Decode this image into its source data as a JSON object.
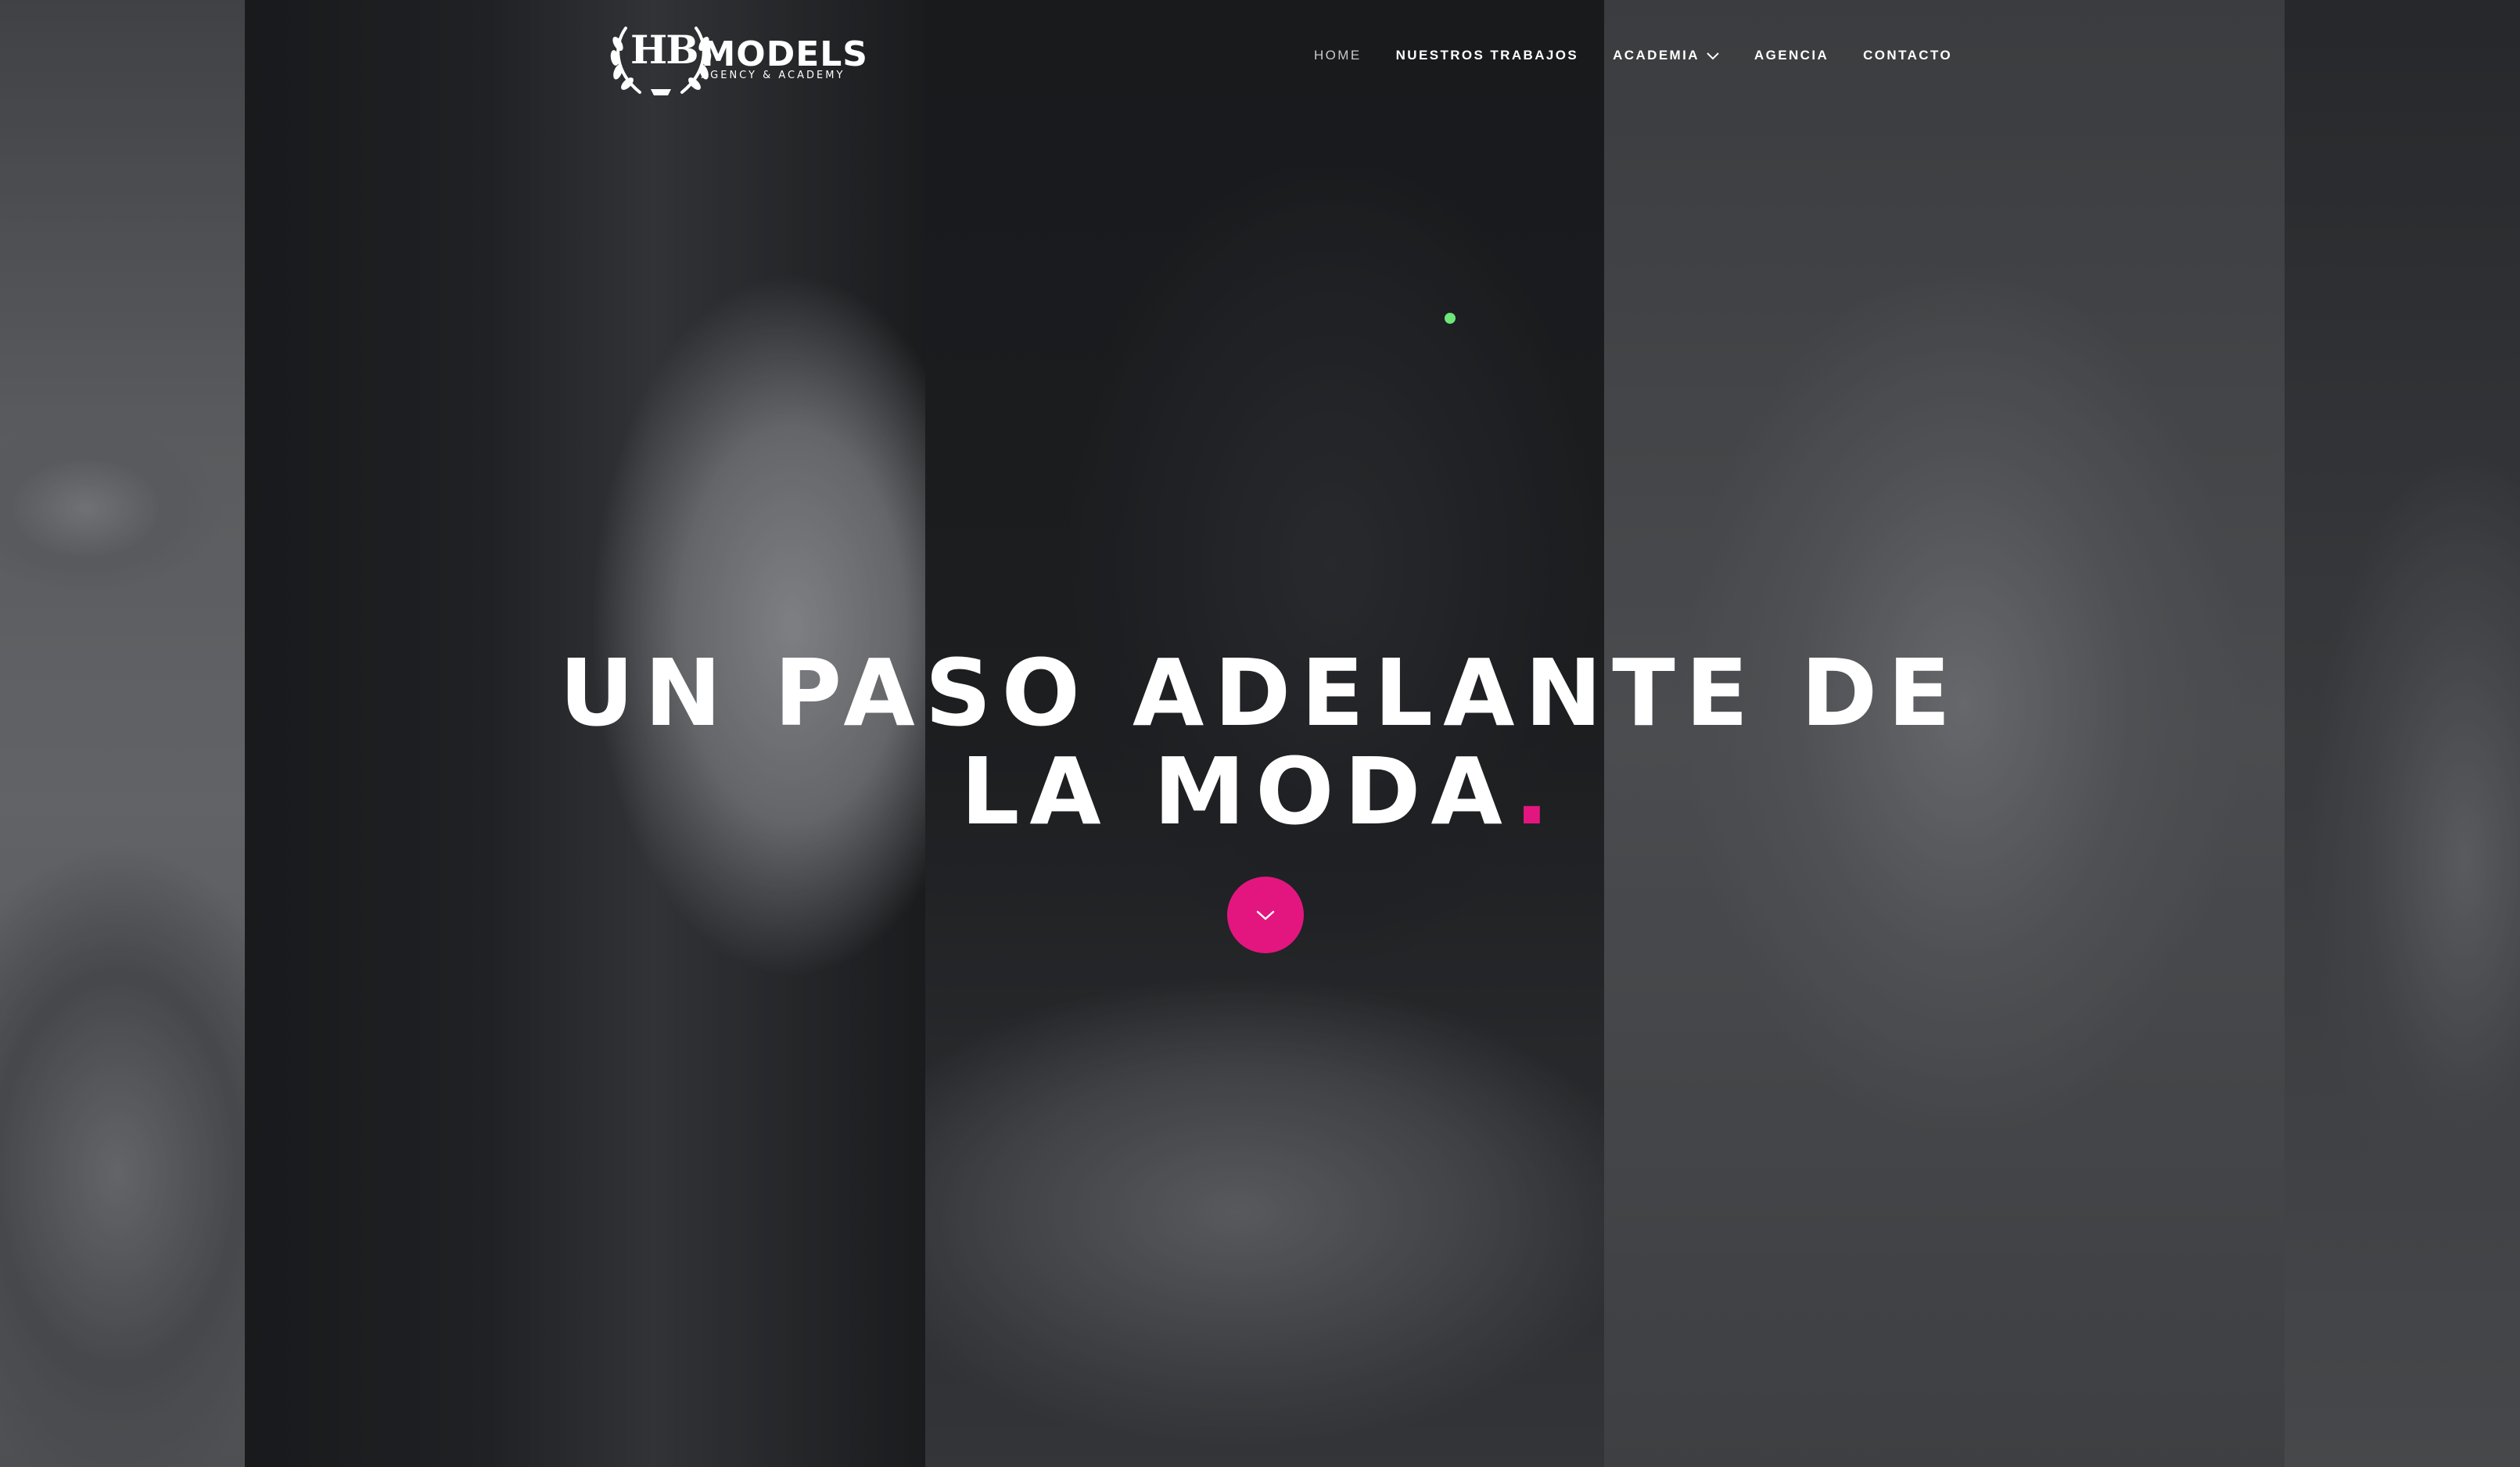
{
  "brand": {
    "emblem_text": "HB",
    "name": "MODELS",
    "tagline": "AGENCY & ACADEMY"
  },
  "nav": {
    "items": [
      {
        "label": "HOME",
        "active": true
      },
      {
        "label": "NUESTROS TRABAJOS",
        "active": false
      },
      {
        "label": "ACADEMIA",
        "active": false,
        "has_dropdown": true
      },
      {
        "label": "AGENCIA",
        "active": false
      },
      {
        "label": "CONTACTO",
        "active": false
      }
    ]
  },
  "hero": {
    "line1": "UN PASO ADELANTE DE",
    "line2": "LA MODA",
    "line2_punct": "."
  },
  "scroll_button": {
    "icon": "chevron-down-icon"
  },
  "colors": {
    "accent": "#e3167f",
    "status_dot": "#6ee67a",
    "text": "#ffffff"
  },
  "icons": {
    "logo_wreath": "laurel-wreath-icon",
    "dropdown": "chevron-down-icon"
  }
}
